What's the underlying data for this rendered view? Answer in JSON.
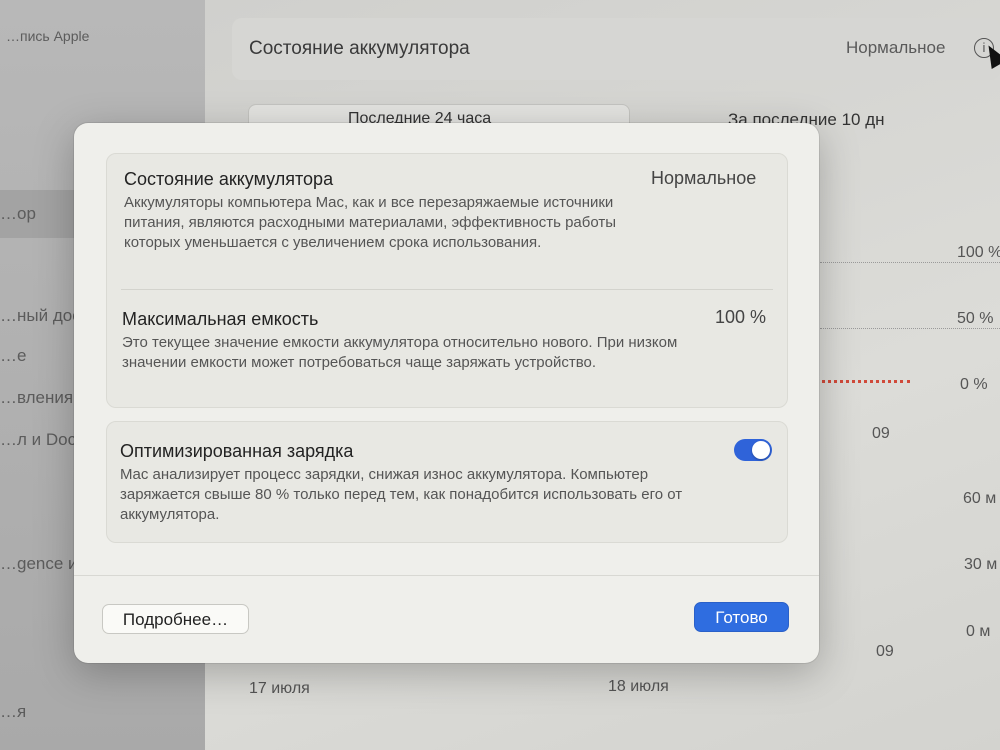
{
  "background": {
    "sidebar": {
      "items": [
        "…пись Apple",
        "…ор",
        "…ный дос…",
        "…е",
        "…вления",
        "…л и Dock",
        "…gence и S…",
        "…я"
      ]
    },
    "header": {
      "title": "Состояние аккумулятора",
      "status": "Нормальное",
      "info_icon": "info-circle-icon"
    },
    "segment": {
      "option_1": "Последние 24 часа",
      "option_2": "За последние 10 дн"
    },
    "chart_axis": {
      "level_ticks": [
        "100 %",
        "50 %",
        "0 %"
      ],
      "time_ticks": [
        "60 м",
        "30 м",
        "0 м"
      ],
      "hour_labels": [
        "09",
        "09"
      ],
      "date_labels": [
        "17 июля",
        "18 июля"
      ]
    }
  },
  "dialog": {
    "battery_condition": {
      "title": "Состояние аккумулятора",
      "value": "Нормальное",
      "description": "Аккумуляторы компьютера Mac, как и все перезаряжаемые источники питания, являются расходными материалами, эффективность работы которых уменьшается с увеличением срока использования."
    },
    "max_capacity": {
      "title": "Максимальная емкость",
      "value": "100 %",
      "description": "Это текущее значение емкости аккумулятора относительно нового. При низком значении емкости может потребоваться чаще заряжать устройство."
    },
    "optimized_charging": {
      "title": "Оптимизированная зарядка",
      "enabled": true,
      "description": "Mac анализирует процесс зарядки, снижая износ аккумулятора. Компьютер заряжается свыше 80 % только перед тем, как понадобится использовать его от аккумулятора."
    },
    "buttons": {
      "more": "Подробнее…",
      "done": "Готово"
    }
  },
  "colors": {
    "accent": "#2f6de0",
    "toggle_on": "#2f63d9"
  }
}
